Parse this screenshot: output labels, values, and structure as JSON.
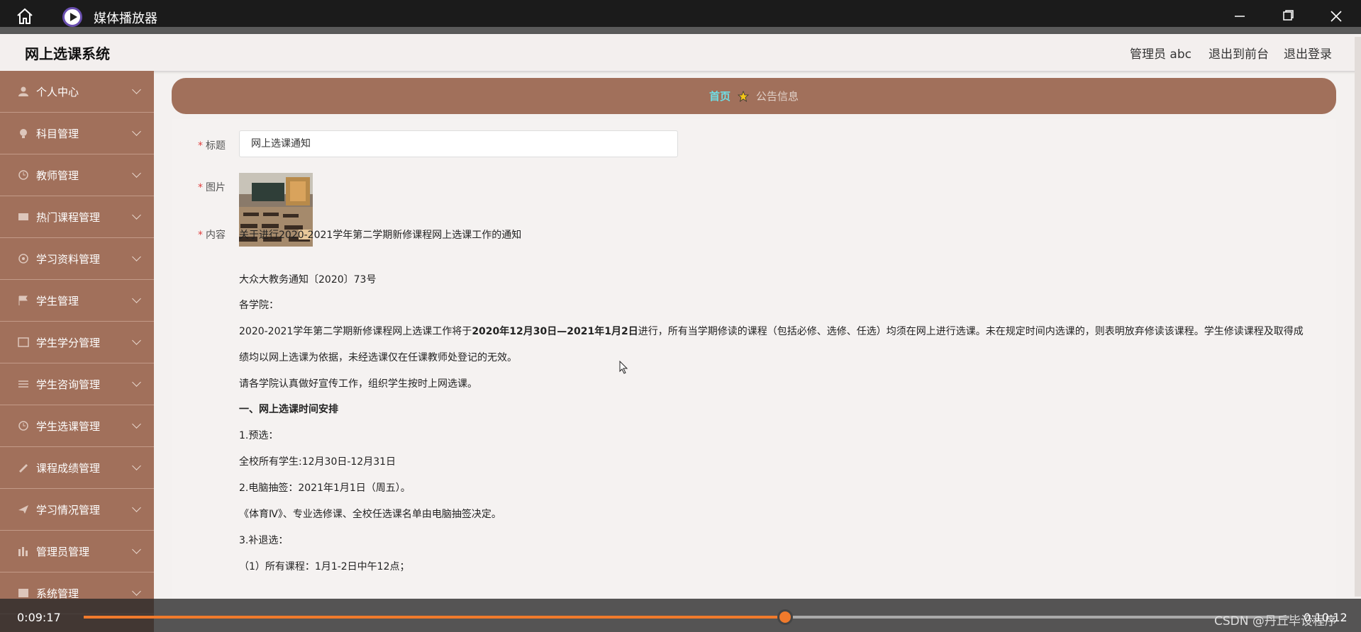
{
  "player": {
    "title": "媒体播放器",
    "home_icon": "home-icon",
    "app_icon": "media-player-icon",
    "current_time": "0:09:17",
    "end_time": "0:10:12",
    "progress": 0.582,
    "watermark": "CSDN @丹丘毕设程序"
  },
  "app": {
    "title": "网上选课系统",
    "header_links": [
      "管理员 abc",
      "退出到前台",
      "退出登录"
    ]
  },
  "sidebar": {
    "items": [
      {
        "label": "个人中心",
        "icon": "user-icon"
      },
      {
        "label": "科目管理",
        "icon": "bulb-icon"
      },
      {
        "label": "教师管理",
        "icon": "teacher-icon"
      },
      {
        "label": "热门课程管理",
        "icon": "course-icon"
      },
      {
        "label": "学习资料管理",
        "icon": "material-icon"
      },
      {
        "label": "学生管理",
        "icon": "flag-icon"
      },
      {
        "label": "学生学分管理",
        "icon": "credit-icon"
      },
      {
        "label": "学生咨询管理",
        "icon": "list-icon"
      },
      {
        "label": "学生选课管理",
        "icon": "clock-icon"
      },
      {
        "label": "课程成绩管理",
        "icon": "grade-icon"
      },
      {
        "label": "学习情况管理",
        "icon": "plane-icon"
      },
      {
        "label": "管理员管理",
        "icon": "admin-icon"
      },
      {
        "label": "系统管理",
        "icon": "system-icon"
      }
    ]
  },
  "breadcrumb": {
    "home": "首页",
    "current": "公告信息",
    "icon": "star-icon"
  },
  "form": {
    "title_label": "标题",
    "title_value": "网上选课通知",
    "image_label": "图片",
    "content_label": "内容"
  },
  "notice": {
    "heading": "关于进行2020-2021学年第二学期新修课程网上选课工作的通知",
    "doc_no": "大众大教务通知〔2020〕73号",
    "greeting": "各学院：",
    "p1_a": "2020-2021学年第二学期新修课程网上选课工作将于",
    "p1_b": "2020年12月30日—2021年1月2日",
    "p1_c": "进行，所有当学期修读的课程（包括必修、选修、任选）均须在网上进行选课。未在规定时间内选课的，则表明放弃修读该课程。学生修读课程及取得成",
    "p2": "绩均以网上选课为依据，未经选课仅在任课教师处登记的无效。",
    "p3": "请各学院认真做好宣传工作，组织学生按时上网选课。",
    "s1": "一、网上选课时间安排",
    "s1_1": "1.预选：",
    "s1_1_text": "全校所有学生:12月30日-12月31日",
    "s1_2": "2.电脑抽签：2021年1月1日（周五）。",
    "s1_2_text": "《体育Ⅳ》、专业选修课、全校任选课名单由电脑抽签决定。",
    "s1_3": "3.补退选：",
    "s1_3_text": "（1）所有课程：1月1-2日中午12点；"
  }
}
